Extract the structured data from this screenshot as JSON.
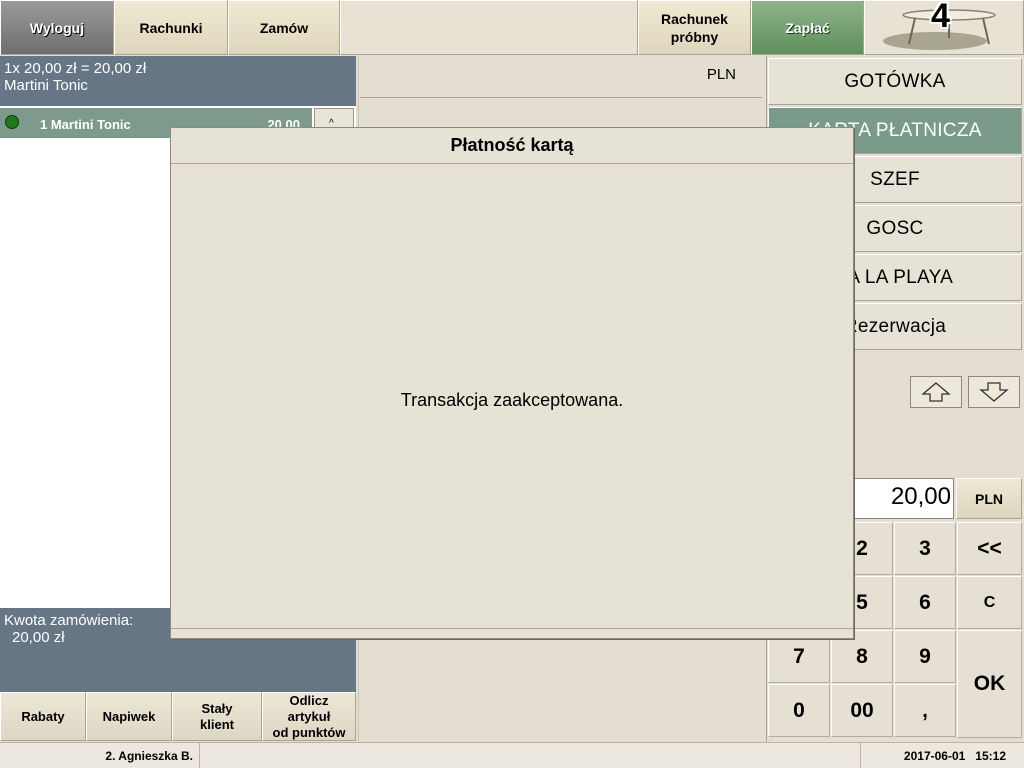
{
  "toolbar": {
    "logout": "Wyloguj",
    "bills": "Rachunki",
    "order": "Zamów",
    "test_bill_line1": "Rachunek",
    "test_bill_line2": "próbny",
    "pay": "Zapłać",
    "table_number": "4"
  },
  "order": {
    "summary_line": "1x 20,00 zł =  20,00 zł",
    "item_name": "Martini Tonic",
    "row_text": "1 Martini Tonic",
    "row_price": "20,00",
    "total_label": "Kwota zamówienia:",
    "total_value": "20,00 zł"
  },
  "currency_panel": {
    "label": "PLN"
  },
  "payment_methods": [
    {
      "label": "GOTÓWKA"
    },
    {
      "label": "KARTA PŁATNICZA"
    },
    {
      "label": "SZEF"
    },
    {
      "label": "GOSC"
    },
    {
      "label": "TA LA PLAYA"
    },
    {
      "label": "Rezerwacja"
    }
  ],
  "amount": {
    "value": "20,00",
    "currency": "PLN"
  },
  "keypad": {
    "k2": "2",
    "k3": "3",
    "back": "<<",
    "k5": "5",
    "k6": "6",
    "clear": "C",
    "k7": "7",
    "k8": "8",
    "k9": "9",
    "k0": "0",
    "k00": "00",
    "comma": ",",
    "ok": "OK"
  },
  "bottom_buttons": {
    "discounts": "Rabaty",
    "tip": "Napiwek",
    "regular_line1": "Stały",
    "regular_line2": "klient",
    "points_line1": "Odlicz",
    "points_line2": "artykuł",
    "points_line3": "od punktów"
  },
  "status_bar": {
    "user": "2. Agnieszka B.",
    "datetime": "2017-06-01   15:12"
  },
  "dialog": {
    "title": "Płatność kartą",
    "message": "Transakcja zaakceptowana."
  },
  "colors": {
    "panel_slate": "#667685",
    "order_row": "#7e9a8c",
    "active_method": "#7a9a8a",
    "pay_button": "#6f9c6b",
    "status_led": "#1c7a1c"
  }
}
